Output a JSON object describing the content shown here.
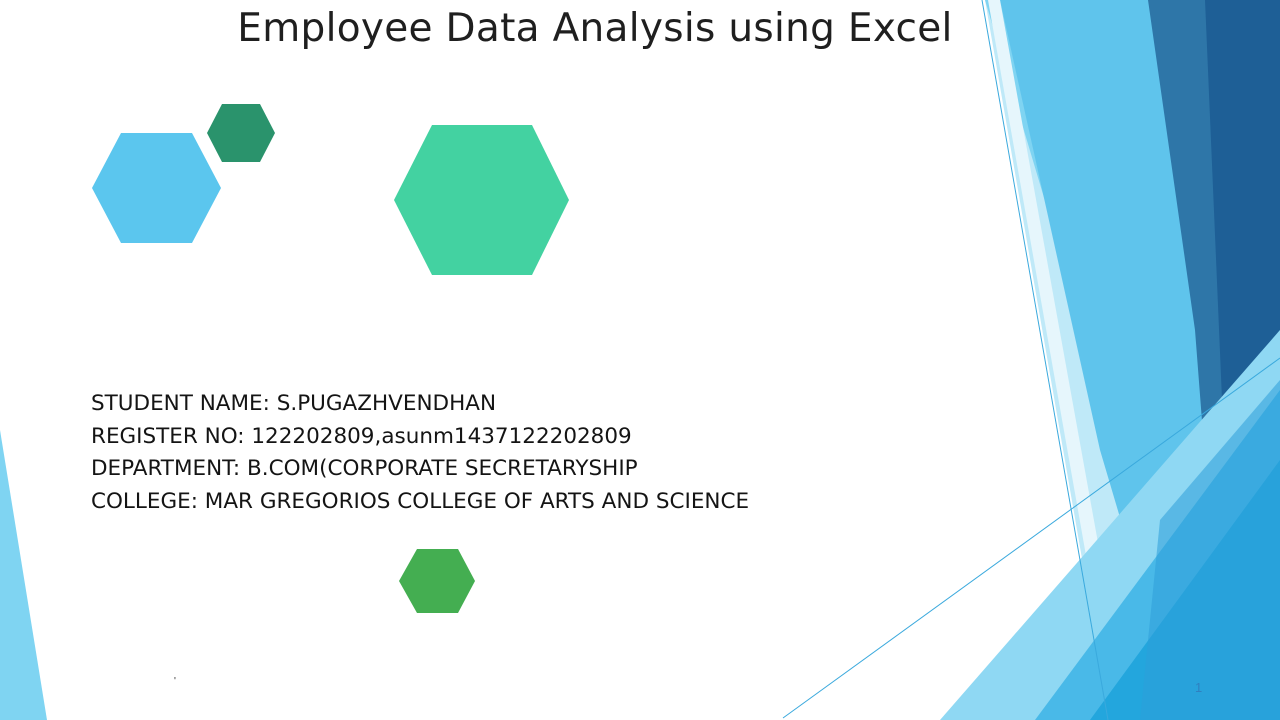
{
  "slide": {
    "title": "Employee Data Analysis using Excel",
    "details": [
      "STUDENT NAME: S.PUGAZHVENDHAN",
      "REGISTER NO: 122202809,asunm1437122202809",
      "DEPARTMENT: B.COM(CORPORATE SECRETARYSHIP",
      "COLLEGE: MAR GREGORIOS COLLEGE OF ARTS AND SCIENCE"
    ],
    "slide_number": "1",
    "stray_mark": "'"
  },
  "hexagons": [
    {
      "name": "hexagon-light-blue",
      "color": "#5bc6ee"
    },
    {
      "name": "hexagon-dark-green",
      "color": "#2a936c"
    },
    {
      "name": "hexagon-mint-green",
      "color": "#43d2a1"
    },
    {
      "name": "hexagon-green",
      "color": "#44ae51"
    }
  ],
  "theme_colors": {
    "light_blue": "#7fd4f2",
    "sky_blue": "#49b9e8",
    "mid_blue": "#2e76a8",
    "deep_blue": "#1e5f96",
    "cyan_blue": "#23a6dd"
  }
}
